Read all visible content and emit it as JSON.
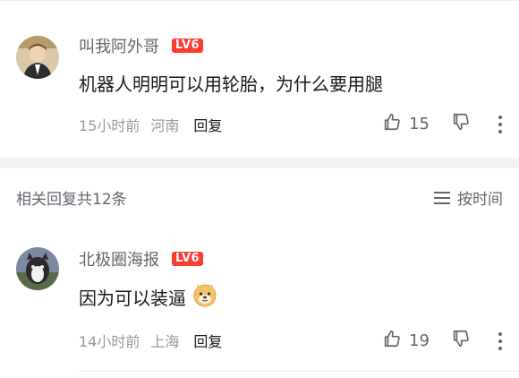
{
  "comments": [
    {
      "username": "叫我阿外哥",
      "level": "LV6",
      "text": "机器人明明可以用轮胎，为什么要用腿",
      "time": "15小时前",
      "location": "河南",
      "reply_label": "回复",
      "likes": "15"
    },
    {
      "username": "北极圈海报",
      "level": "LV6",
      "text": "因为可以装逼",
      "time": "14小时前",
      "location": "上海",
      "reply_label": "回复",
      "likes": "19"
    }
  ],
  "related": {
    "title": "相关回复共12条",
    "sort_label": "按时间"
  },
  "colors": {
    "level_badge": "#ff3b30",
    "username": "#61666d",
    "meta": "#9499a0"
  },
  "icons": [
    "thumb-up-icon",
    "thumb-down-icon",
    "more-vertical-icon",
    "sort-menu-icon",
    "doge-emoji-icon"
  ]
}
